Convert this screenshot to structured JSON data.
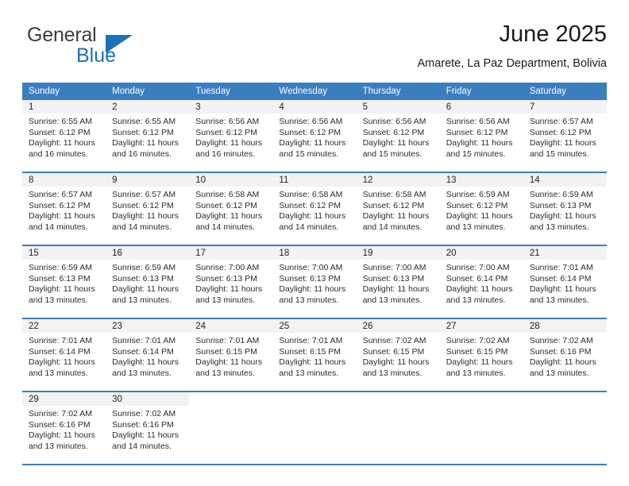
{
  "brand": {
    "name_part1": "General",
    "name_part2": "Blue",
    "accent_color": "#1b72b8"
  },
  "header": {
    "title": "June 2025",
    "subtitle": "Amarete, La Paz Department, Bolivia"
  },
  "calendar": {
    "header_bg": "#3a7ebf",
    "daynum_bg": "#f2f2f2",
    "weekday_headers": [
      "Sunday",
      "Monday",
      "Tuesday",
      "Wednesday",
      "Thursday",
      "Friday",
      "Saturday"
    ],
    "weeks": [
      [
        {
          "day": "1",
          "sunrise": "Sunrise: 6:55 AM",
          "sunset": "Sunset: 6:12 PM",
          "daylight_line1": "Daylight: 11 hours",
          "daylight_line2": "and 16 minutes."
        },
        {
          "day": "2",
          "sunrise": "Sunrise: 6:55 AM",
          "sunset": "Sunset: 6:12 PM",
          "daylight_line1": "Daylight: 11 hours",
          "daylight_line2": "and 16 minutes."
        },
        {
          "day": "3",
          "sunrise": "Sunrise: 6:56 AM",
          "sunset": "Sunset: 6:12 PM",
          "daylight_line1": "Daylight: 11 hours",
          "daylight_line2": "and 16 minutes."
        },
        {
          "day": "4",
          "sunrise": "Sunrise: 6:56 AM",
          "sunset": "Sunset: 6:12 PM",
          "daylight_line1": "Daylight: 11 hours",
          "daylight_line2": "and 15 minutes."
        },
        {
          "day": "5",
          "sunrise": "Sunrise: 6:56 AM",
          "sunset": "Sunset: 6:12 PM",
          "daylight_line1": "Daylight: 11 hours",
          "daylight_line2": "and 15 minutes."
        },
        {
          "day": "6",
          "sunrise": "Sunrise: 6:56 AM",
          "sunset": "Sunset: 6:12 PM",
          "daylight_line1": "Daylight: 11 hours",
          "daylight_line2": "and 15 minutes."
        },
        {
          "day": "7",
          "sunrise": "Sunrise: 6:57 AM",
          "sunset": "Sunset: 6:12 PM",
          "daylight_line1": "Daylight: 11 hours",
          "daylight_line2": "and 15 minutes."
        }
      ],
      [
        {
          "day": "8",
          "sunrise": "Sunrise: 6:57 AM",
          "sunset": "Sunset: 6:12 PM",
          "daylight_line1": "Daylight: 11 hours",
          "daylight_line2": "and 14 minutes."
        },
        {
          "day": "9",
          "sunrise": "Sunrise: 6:57 AM",
          "sunset": "Sunset: 6:12 PM",
          "daylight_line1": "Daylight: 11 hours",
          "daylight_line2": "and 14 minutes."
        },
        {
          "day": "10",
          "sunrise": "Sunrise: 6:58 AM",
          "sunset": "Sunset: 6:12 PM",
          "daylight_line1": "Daylight: 11 hours",
          "daylight_line2": "and 14 minutes."
        },
        {
          "day": "11",
          "sunrise": "Sunrise: 6:58 AM",
          "sunset": "Sunset: 6:12 PM",
          "daylight_line1": "Daylight: 11 hours",
          "daylight_line2": "and 14 minutes."
        },
        {
          "day": "12",
          "sunrise": "Sunrise: 6:58 AM",
          "sunset": "Sunset: 6:12 PM",
          "daylight_line1": "Daylight: 11 hours",
          "daylight_line2": "and 14 minutes."
        },
        {
          "day": "13",
          "sunrise": "Sunrise: 6:59 AM",
          "sunset": "Sunset: 6:12 PM",
          "daylight_line1": "Daylight: 11 hours",
          "daylight_line2": "and 13 minutes."
        },
        {
          "day": "14",
          "sunrise": "Sunrise: 6:59 AM",
          "sunset": "Sunset: 6:13 PM",
          "daylight_line1": "Daylight: 11 hours",
          "daylight_line2": "and 13 minutes."
        }
      ],
      [
        {
          "day": "15",
          "sunrise": "Sunrise: 6:59 AM",
          "sunset": "Sunset: 6:13 PM",
          "daylight_line1": "Daylight: 11 hours",
          "daylight_line2": "and 13 minutes."
        },
        {
          "day": "16",
          "sunrise": "Sunrise: 6:59 AM",
          "sunset": "Sunset: 6:13 PM",
          "daylight_line1": "Daylight: 11 hours",
          "daylight_line2": "and 13 minutes."
        },
        {
          "day": "17",
          "sunrise": "Sunrise: 7:00 AM",
          "sunset": "Sunset: 6:13 PM",
          "daylight_line1": "Daylight: 11 hours",
          "daylight_line2": "and 13 minutes."
        },
        {
          "day": "18",
          "sunrise": "Sunrise: 7:00 AM",
          "sunset": "Sunset: 6:13 PM",
          "daylight_line1": "Daylight: 11 hours",
          "daylight_line2": "and 13 minutes."
        },
        {
          "day": "19",
          "sunrise": "Sunrise: 7:00 AM",
          "sunset": "Sunset: 6:13 PM",
          "daylight_line1": "Daylight: 11 hours",
          "daylight_line2": "and 13 minutes."
        },
        {
          "day": "20",
          "sunrise": "Sunrise: 7:00 AM",
          "sunset": "Sunset: 6:14 PM",
          "daylight_line1": "Daylight: 11 hours",
          "daylight_line2": "and 13 minutes."
        },
        {
          "day": "21",
          "sunrise": "Sunrise: 7:01 AM",
          "sunset": "Sunset: 6:14 PM",
          "daylight_line1": "Daylight: 11 hours",
          "daylight_line2": "and 13 minutes."
        }
      ],
      [
        {
          "day": "22",
          "sunrise": "Sunrise: 7:01 AM",
          "sunset": "Sunset: 6:14 PM",
          "daylight_line1": "Daylight: 11 hours",
          "daylight_line2": "and 13 minutes."
        },
        {
          "day": "23",
          "sunrise": "Sunrise: 7:01 AM",
          "sunset": "Sunset: 6:14 PM",
          "daylight_line1": "Daylight: 11 hours",
          "daylight_line2": "and 13 minutes."
        },
        {
          "day": "24",
          "sunrise": "Sunrise: 7:01 AM",
          "sunset": "Sunset: 6:15 PM",
          "daylight_line1": "Daylight: 11 hours",
          "daylight_line2": "and 13 minutes."
        },
        {
          "day": "25",
          "sunrise": "Sunrise: 7:01 AM",
          "sunset": "Sunset: 6:15 PM",
          "daylight_line1": "Daylight: 11 hours",
          "daylight_line2": "and 13 minutes."
        },
        {
          "day": "26",
          "sunrise": "Sunrise: 7:02 AM",
          "sunset": "Sunset: 6:15 PM",
          "daylight_line1": "Daylight: 11 hours",
          "daylight_line2": "and 13 minutes."
        },
        {
          "day": "27",
          "sunrise": "Sunrise: 7:02 AM",
          "sunset": "Sunset: 6:15 PM",
          "daylight_line1": "Daylight: 11 hours",
          "daylight_line2": "and 13 minutes."
        },
        {
          "day": "28",
          "sunrise": "Sunrise: 7:02 AM",
          "sunset": "Sunset: 6:16 PM",
          "daylight_line1": "Daylight: 11 hours",
          "daylight_line2": "and 13 minutes."
        }
      ],
      [
        {
          "day": "29",
          "sunrise": "Sunrise: 7:02 AM",
          "sunset": "Sunset: 6:16 PM",
          "daylight_line1": "Daylight: 11 hours",
          "daylight_line2": "and 13 minutes."
        },
        {
          "day": "30",
          "sunrise": "Sunrise: 7:02 AM",
          "sunset": "Sunset: 6:16 PM",
          "daylight_line1": "Daylight: 11 hours",
          "daylight_line2": "and 14 minutes."
        },
        {
          "day": "",
          "sunrise": "",
          "sunset": "",
          "daylight_line1": "",
          "daylight_line2": "",
          "blank": true
        },
        {
          "day": "",
          "sunrise": "",
          "sunset": "",
          "daylight_line1": "",
          "daylight_line2": "",
          "blank": true
        },
        {
          "day": "",
          "sunrise": "",
          "sunset": "",
          "daylight_line1": "",
          "daylight_line2": "",
          "blank": true
        },
        {
          "day": "",
          "sunrise": "",
          "sunset": "",
          "daylight_line1": "",
          "daylight_line2": "",
          "blank": true
        },
        {
          "day": "",
          "sunrise": "",
          "sunset": "",
          "daylight_line1": "",
          "daylight_line2": "",
          "blank": true
        }
      ]
    ]
  }
}
